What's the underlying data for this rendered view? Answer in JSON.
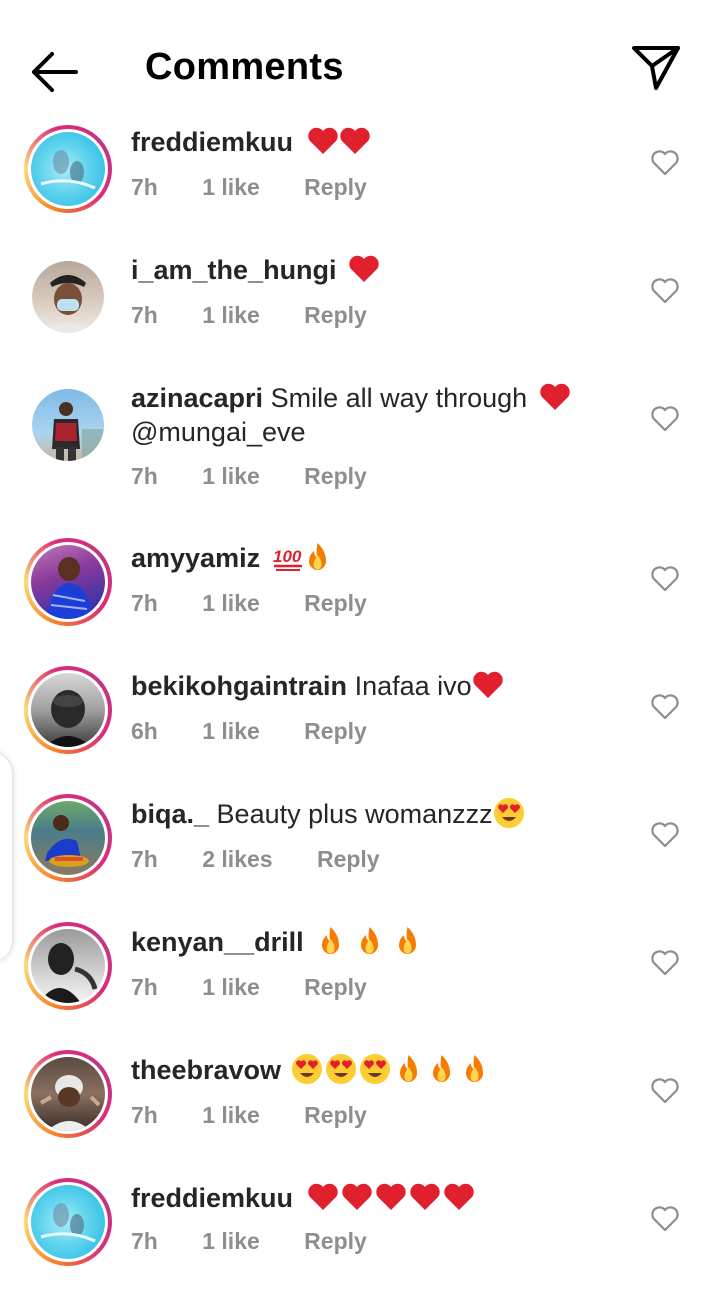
{
  "header": {
    "title": "Comments",
    "back_icon": "arrow-left-icon",
    "share_icon": "send-icon"
  },
  "colors": {
    "meta_gray": "#8e8e8e",
    "text": "#262626",
    "heart_red": "#e0202c",
    "ring_start": "#f58529",
    "ring_end": "#c13584"
  },
  "comments": [
    {
      "username": "freddiemkuu",
      "text": "",
      "emoji": [
        "heart",
        "heart"
      ],
      "time": "7h",
      "likes": "1 like",
      "reply": "Reply",
      "ring": true
    },
    {
      "username": "i_am_the_hungi",
      "text": "",
      "emoji": [
        "heart"
      ],
      "time": "7h",
      "likes": "1 like",
      "reply": "Reply",
      "ring": false
    },
    {
      "username": "azinacapri",
      "text": "Smile all way through",
      "text2": "@mungai_eve",
      "emoji": [
        "heart"
      ],
      "time": "7h",
      "likes": "1 like",
      "reply": "Reply",
      "ring": false
    },
    {
      "username": "amyyamiz",
      "text": "",
      "emoji": [
        "hundred",
        "fire"
      ],
      "time": "7h",
      "likes": "1 like",
      "reply": "Reply",
      "ring": true
    },
    {
      "username": "bekikohgaintrain",
      "text": "Inafaa ivo",
      "emoji": [
        "heart"
      ],
      "time": "6h",
      "likes": "1 like",
      "reply": "Reply",
      "ring": true
    },
    {
      "username": "biqa._",
      "text": "Beauty plus womanzzz",
      "emoji": [
        "love"
      ],
      "time": "7h",
      "likes": "2 likes",
      "reply": "Reply",
      "ring": true
    },
    {
      "username": "kenyan__drill",
      "text": "",
      "emoji": [
        "fire",
        "fire",
        "fire"
      ],
      "time": "7h",
      "likes": "1 like",
      "reply": "Reply",
      "ring": true
    },
    {
      "username": "theebravow",
      "text": "",
      "emoji": [
        "love",
        "love",
        "love",
        "fire",
        "fire",
        "fire"
      ],
      "time": "7h",
      "likes": "1 like",
      "reply": "Reply",
      "ring": true
    },
    {
      "username": "freddiemkuu",
      "text": "",
      "emoji": [
        "heart",
        "heart",
        "heart",
        "heart",
        "heart"
      ],
      "time": "7h",
      "likes": "1 like",
      "reply": "Reply",
      "ring": true
    }
  ]
}
